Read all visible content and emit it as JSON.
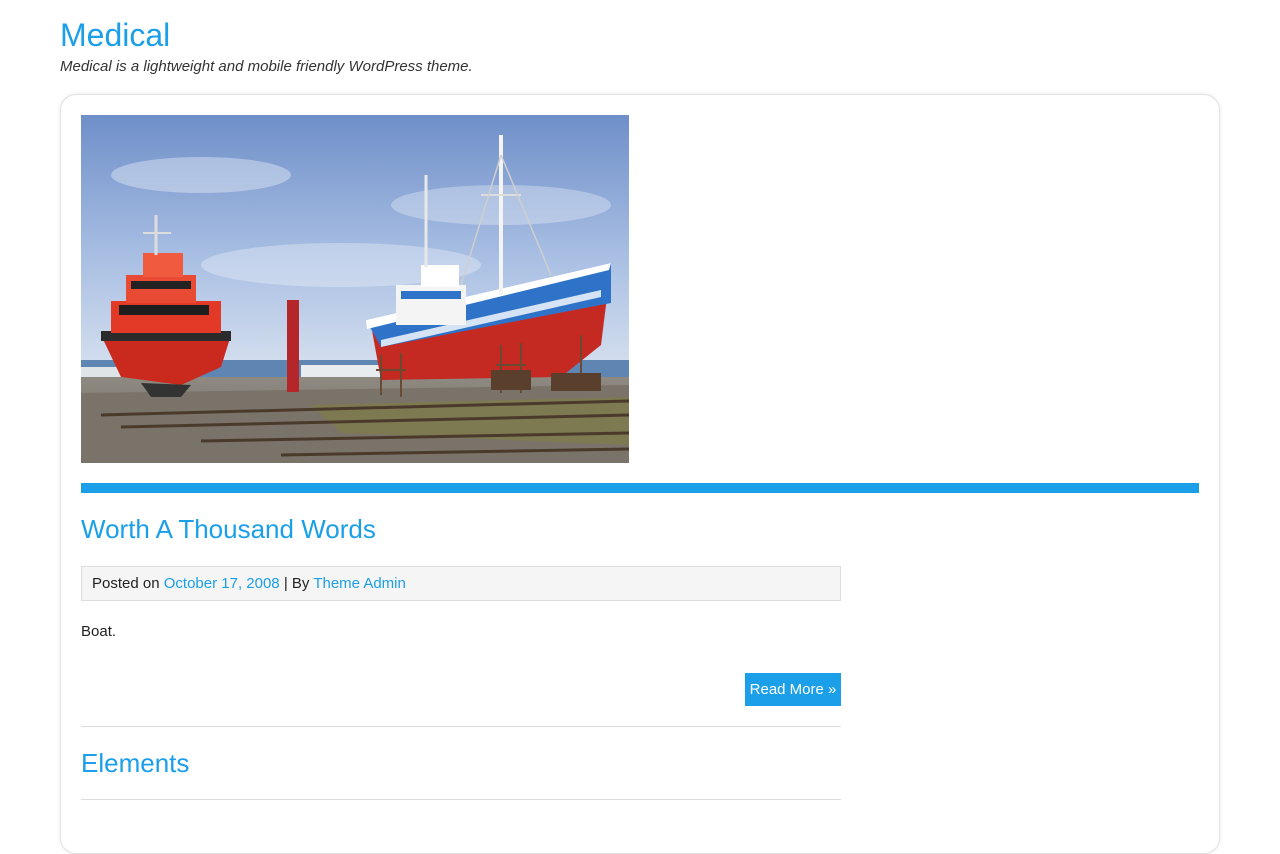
{
  "site": {
    "title": "Medical",
    "tagline": "Medical is a lightweight and mobile friendly WordPress theme."
  },
  "colors": {
    "accent": "#1a9fe8",
    "meta_background": "#f5f5f5",
    "border": "#dddddd"
  },
  "featured_image": {
    "icon": "photo-boats-in-drydock"
  },
  "posts": [
    {
      "title": "Worth A Thousand Words",
      "meta": {
        "posted_on_label": "Posted on",
        "date": "October 17, 2008",
        "separator": "| By",
        "author": "Theme Admin"
      },
      "excerpt": "Boat.",
      "read_more_label": "Read More »"
    },
    {
      "title": "Elements"
    }
  ]
}
